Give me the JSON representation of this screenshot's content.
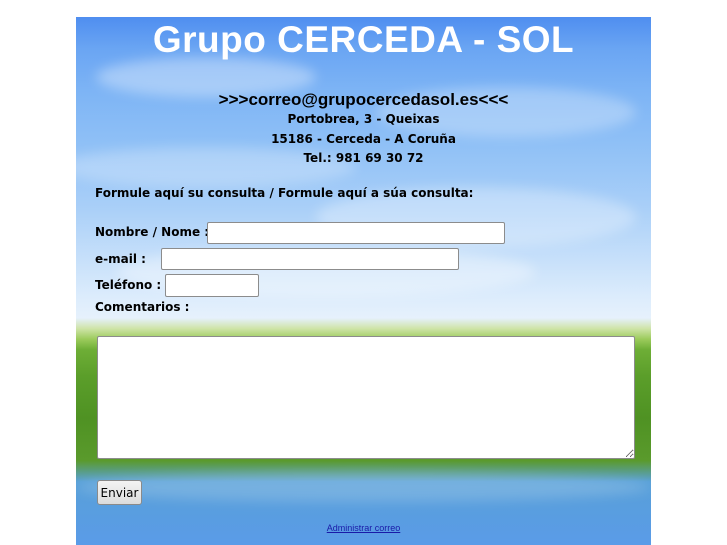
{
  "header": {
    "title": "Grupo CERCEDA - SOL",
    "email": ">>>correo@grupocercedasol.es<<<",
    "address_line1": "Portobrea, 3 - Queixas",
    "address_line2": "15186 - Cerceda - A Coruña",
    "phone": "Tel.: 981 69 30 72"
  },
  "form": {
    "intro": "Formule aquí su consulta / Formule aquí a súa consulta:",
    "name_label": "Nombre / Nome :",
    "name_value": "",
    "email_label": "e-mail :",
    "email_value": "",
    "phone_label": "Teléfono :",
    "phone_value": "",
    "comments_label": "Comentarios :",
    "comments_value": "",
    "submit_label": "Enviar"
  },
  "footer": {
    "admin_link": "Administrar correo"
  },
  "colors": {
    "title": "#ffffff",
    "link": "#1a1aa8",
    "sky": "#6aa5f3",
    "grass": "#5b9e2a"
  }
}
